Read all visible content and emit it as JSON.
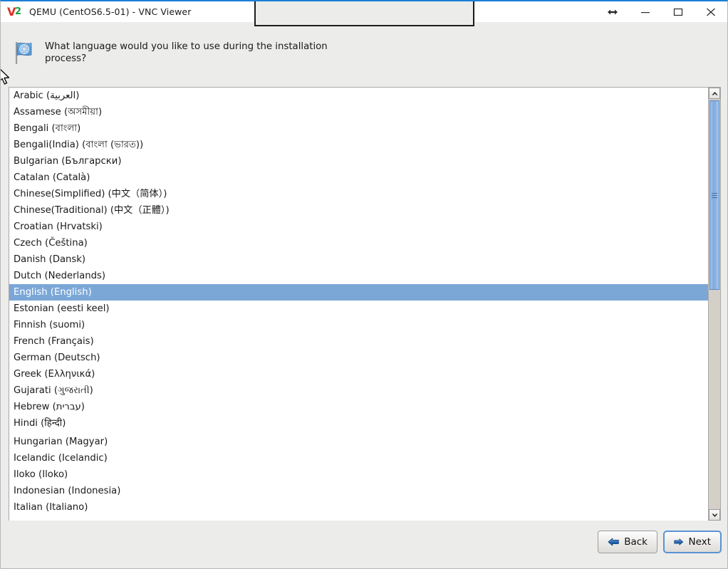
{
  "window": {
    "title": "QEMU (CentOS6.5-01) - VNC Viewer",
    "logo_primary": "V",
    "logo_secondary": "2",
    "accent_color": "#1a7fd4",
    "controls": [
      {
        "name": "resize-horizontal",
        "label": "Resize"
      },
      {
        "name": "minimize",
        "label": "Minimize"
      },
      {
        "name": "maximize",
        "label": "Maximize"
      },
      {
        "name": "close",
        "label": "Close"
      }
    ]
  },
  "header": {
    "icon": "un-flag-icon",
    "question": "What language would you like to use during the installation process?"
  },
  "language_list": {
    "selected": "English (English)",
    "selection_color": "#7ba7d7",
    "items": [
      {
        "label": "Arabic (العربية)",
        "selected": false
      },
      {
        "label": "Assamese (অসমীয়া)",
        "selected": false
      },
      {
        "label": "Bengali (বাংলা)",
        "selected": false
      },
      {
        "label": "Bengali(India) (বাংলা (ভারত))",
        "selected": false
      },
      {
        "label": "Bulgarian (Български)",
        "selected": false
      },
      {
        "label": "Catalan (Català)",
        "selected": false
      },
      {
        "label": "Chinese(Simplified) (中文（简体）)",
        "selected": false
      },
      {
        "label": "Chinese(Traditional) (中文（正體）)",
        "selected": false
      },
      {
        "label": "Croatian (Hrvatski)",
        "selected": false
      },
      {
        "label": "Czech (Čeština)",
        "selected": false
      },
      {
        "label": "Danish (Dansk)",
        "selected": false
      },
      {
        "label": "Dutch (Nederlands)",
        "selected": false
      },
      {
        "label": "English (English)",
        "selected": true
      },
      {
        "label": "Estonian (eesti keel)",
        "selected": false
      },
      {
        "label": "Finnish (suomi)",
        "selected": false
      },
      {
        "label": "French (Français)",
        "selected": false
      },
      {
        "label": "German (Deutsch)",
        "selected": false
      },
      {
        "label": "Greek (Ελληνικά)",
        "selected": false
      },
      {
        "label": "Gujarati (ગુજરાતી)",
        "selected": false
      },
      {
        "label": "Hebrew (עברית)",
        "selected": false
      },
      {
        "label": "Hindi (हिन्दी)",
        "selected": false
      },
      {
        "label": "Hungarian (Magyar)",
        "selected": false,
        "gap_above": true
      },
      {
        "label": "Icelandic (Icelandic)",
        "selected": false
      },
      {
        "label": "Iloko (Iloko)",
        "selected": false
      },
      {
        "label": "Indonesian (Indonesia)",
        "selected": false
      },
      {
        "label": "Italian (Italiano)",
        "selected": false
      }
    ]
  },
  "scrollbar": {
    "up_arrow": "scroll-up-icon",
    "down_arrow": "scroll-down-icon",
    "thumb_color": "#7fa9de"
  },
  "footer": {
    "back_label": "Back",
    "next_label": "Next",
    "back_icon": "arrow-left-icon",
    "next_icon": "arrow-right-icon"
  }
}
